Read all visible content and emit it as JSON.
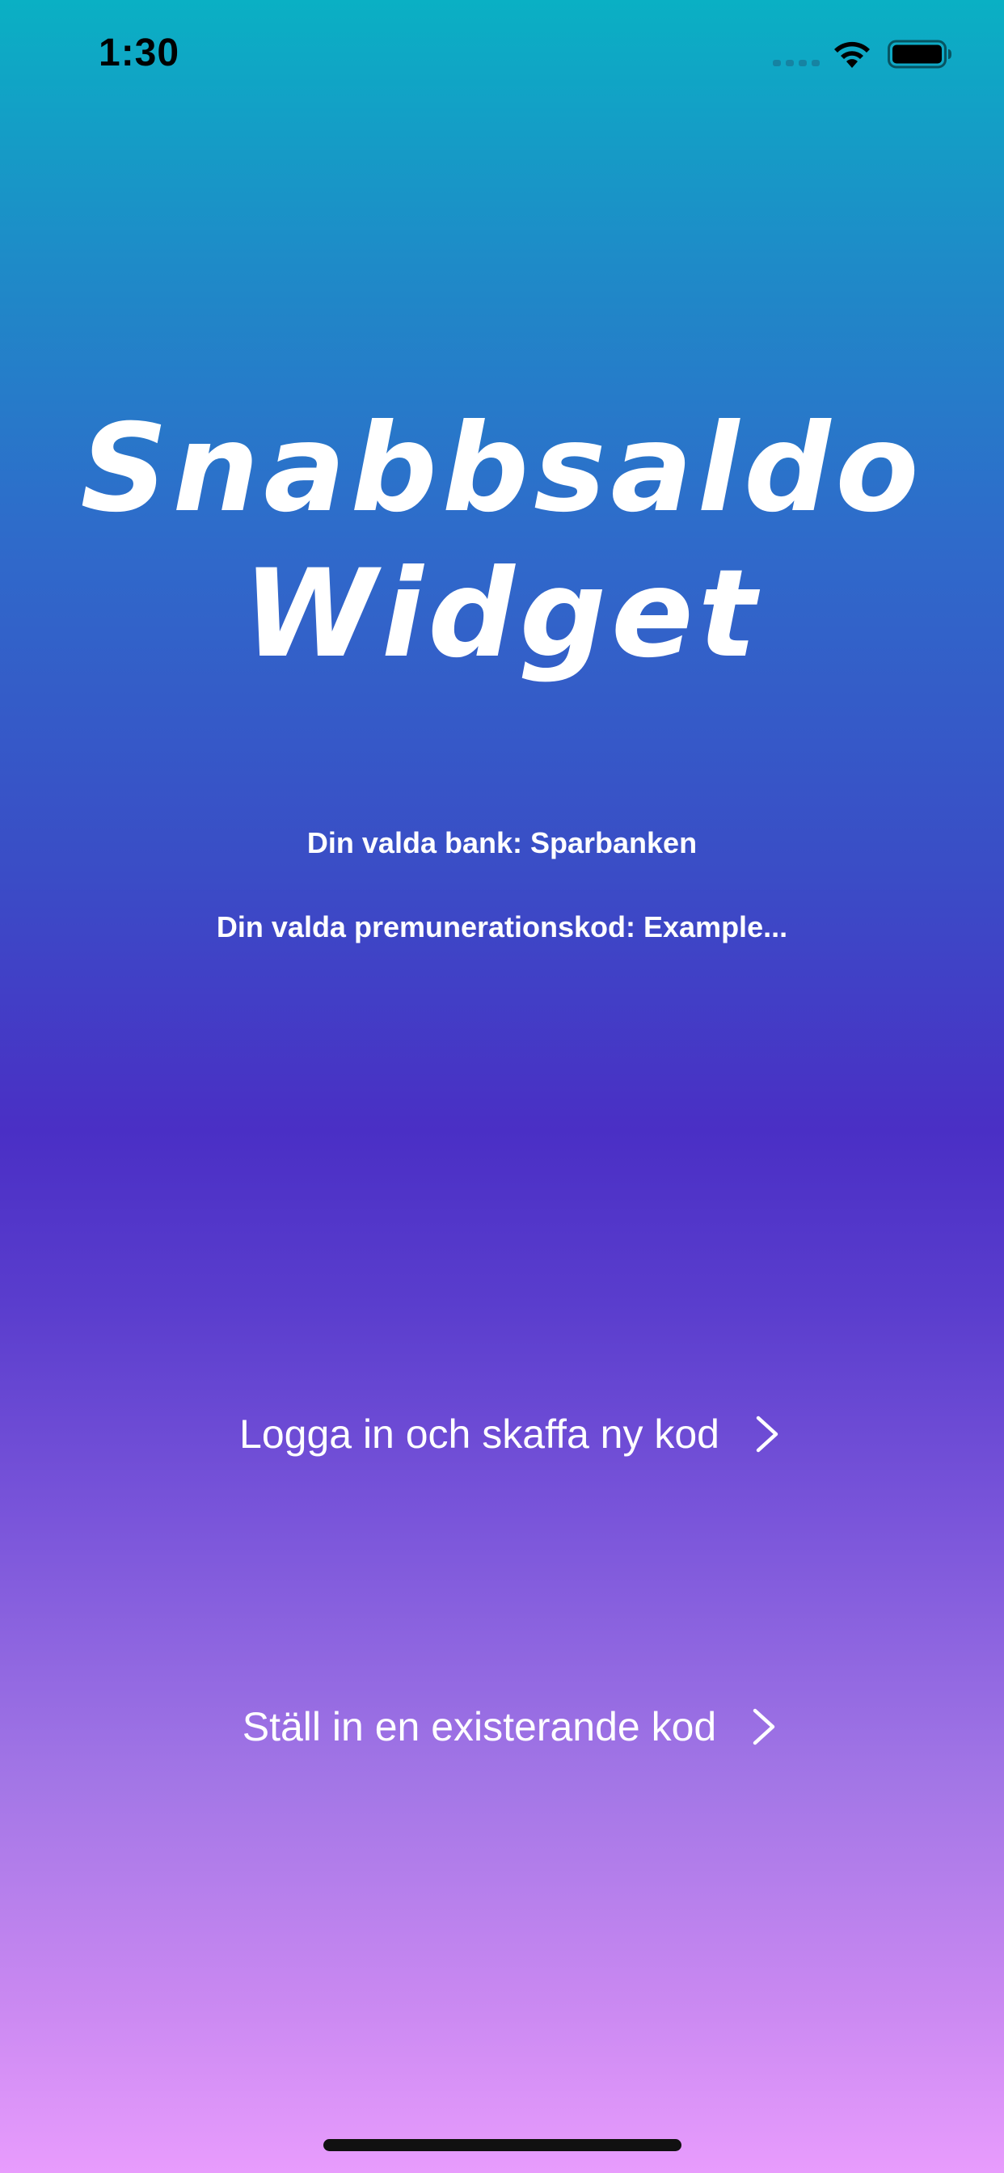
{
  "status_bar": {
    "time": "1:30",
    "icons": [
      "signal-icon",
      "wifi-icon",
      "battery-icon"
    ]
  },
  "title": "Snabbsaldo\nWidget",
  "info": {
    "bank_line": "Din valda bank: Sparbanken",
    "code_line": "Din valda premunerationskod: Example..."
  },
  "buttons": {
    "login": {
      "label": "Logga in och skaffa ny kod",
      "icon": "chevron-right-icon"
    },
    "existing": {
      "label": "Ställ in en existerande kod",
      "icon": "chevron-right-icon"
    }
  },
  "colors": {
    "gradient_top": "#0AB0C4",
    "gradient_mid": "#4A2FC5",
    "gradient_bottom": "#E89CFD",
    "text": "#FFFFFF"
  }
}
